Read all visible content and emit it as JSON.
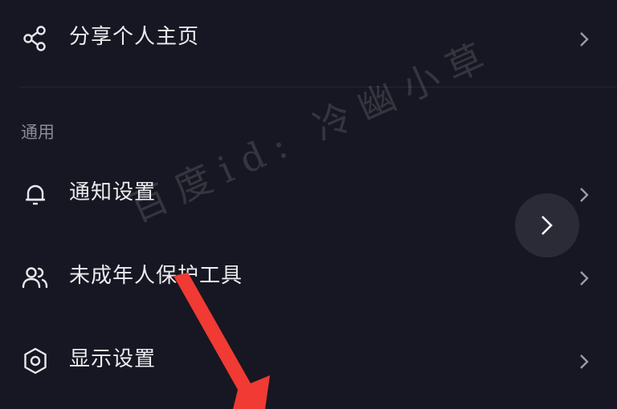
{
  "settings": {
    "share": {
      "label": "分享个人主页",
      "icon": "share-icon"
    },
    "section_general": "通用",
    "items": [
      {
        "label": "通知设置",
        "icon": "bell-icon"
      },
      {
        "label": "未成年人保护工具",
        "icon": "users-icon"
      },
      {
        "label": "显示设置",
        "icon": "gear-icon"
      }
    ]
  },
  "watermark": "百度id: 冷幽小草",
  "colors": {
    "background": "#161722",
    "text": "#ececf0",
    "secondary_text": "#8a8b96",
    "arrow": "#f03a33"
  }
}
